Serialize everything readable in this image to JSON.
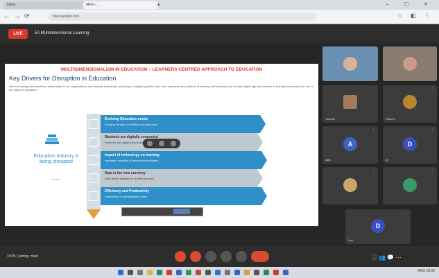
{
  "browser": {
    "tabs": [
      {
        "label": "Inbox"
      },
      {
        "label": "Meet - ..."
      }
    ],
    "new_tab": "+",
    "url": "meet.google.com",
    "window_controls": "– ▢ ✕"
  },
  "meeting": {
    "live_badge": "LIVE",
    "title": "5A Multidimensional Learning",
    "info": "10:05 | joining: meet"
  },
  "slide": {
    "banner": "MULTIDIMENSIONALISM IN EDUCATION – LEARNERS CENTRED APPROACH TO EDUCATION",
    "title": "Key Drivers for Disruption in Education",
    "description": "New technology will transform relationships in our organisations and educate individuals, including re-imagining earlier work; the unprecedented patterns of learning and teaching over the last Digital age will continue to reshape learning by the use of the future of education.",
    "left_caption": "Education Industry is being disrupted",
    "left_sub": "Source",
    "bands": [
      {
        "title": "Evolving Education needs",
        "text": "Growing demand for flexible learning paths",
        "color": "#2e8fc9"
      },
      {
        "title": "Students are digitally connected",
        "text": "Students use digital tools to learn across platforms",
        "color": "#bfc7cf"
      },
      {
        "title": "Impact of technology on learning",
        "text": "Increased adoption of learning technologies",
        "color": "#2e8fc9"
      },
      {
        "title": "Data is the new currency",
        "text": "Data-driven insights for student success",
        "color": "#bfc7cf"
      },
      {
        "title": "Efficiency and Productivity",
        "text": "Automation of administrative tasks",
        "color": "#2e8fc9"
      }
    ]
  },
  "participants": [
    {
      "name": "",
      "initial": "",
      "avatar_color": "#d7b59a"
    },
    {
      "name": "",
      "initial": "",
      "avatar_color": "#c99a86"
    },
    {
      "name": "Teacher",
      "initial": "",
      "avatar_color": "#a57a5a"
    },
    {
      "name": "Student",
      "initial": "",
      "avatar_color": "#b8862a"
    },
    {
      "name": "Alan",
      "initial": "A",
      "avatar_color": "#3b64c2"
    },
    {
      "name": "Dj",
      "initial": "D",
      "avatar_color": "#3b4fc2"
    },
    {
      "name": "",
      "initial": "",
      "avatar_color": "#c9a86a"
    },
    {
      "name": "",
      "initial": "",
      "avatar_color": "#3a9a6a"
    },
    {
      "name": "You",
      "initial": "D",
      "avatar_color": "#3b4fc2"
    }
  ],
  "controls": {
    "right_icons": "ⓘ  👥  💬  ⋯"
  },
  "taskbar": {
    "tray": "ENG  10:05"
  }
}
